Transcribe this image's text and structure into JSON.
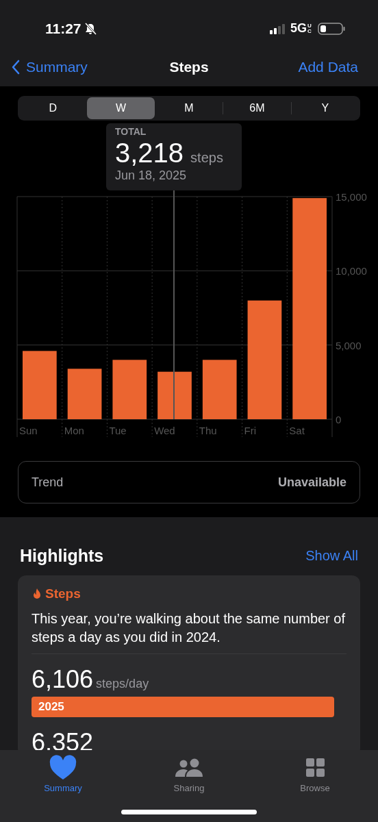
{
  "status_bar": {
    "time": "11:27",
    "network": "5G",
    "network_suffix": "UC"
  },
  "nav": {
    "back": "Summary",
    "title": "Steps",
    "action": "Add Data"
  },
  "ranges": [
    {
      "label": "D",
      "selected": false
    },
    {
      "label": "W",
      "selected": true
    },
    {
      "label": "M",
      "selected": false
    },
    {
      "label": "6M",
      "selected": false
    },
    {
      "label": "Y",
      "selected": false
    }
  ],
  "tooltip": {
    "label": "TOTAL",
    "value": "3,218",
    "unit": "steps",
    "date": "Jun 18, 2025"
  },
  "chart_data": {
    "type": "bar",
    "categories": [
      "Sun",
      "Mon",
      "Tue",
      "Wed",
      "Thu",
      "Fri",
      "Sat"
    ],
    "series": [
      {
        "color": "#eb6530",
        "values": [
          4600,
          3400,
          4000,
          3200,
          4000,
          8000,
          14900
        ]
      }
    ],
    "ylim": [
      0,
      15000
    ],
    "yticks": [
      0,
      {
        "value": 5000,
        "label": "5,000"
      },
      {
        "value": 10000,
        "label": "10,000"
      },
      {
        "value": 15000,
        "label": "15,000"
      }
    ]
  },
  "trend": {
    "label": "Trend",
    "value": "Unavailable"
  },
  "highlights": {
    "title": "Highlights",
    "action": "Show All",
    "card": {
      "category": "Steps",
      "text": "This year, you’re walking about the same number of steps a day as you did in 2024.",
      "rows": [
        {
          "value": "6,106",
          "unit": "steps/day",
          "bar_label": "2025"
        },
        {
          "value": "6,352"
        }
      ]
    }
  },
  "tab_bar": [
    {
      "label": "Summary",
      "selected": true
    },
    {
      "label": "Sharing",
      "selected": false
    },
    {
      "label": "Browse",
      "selected": false
    }
  ]
}
